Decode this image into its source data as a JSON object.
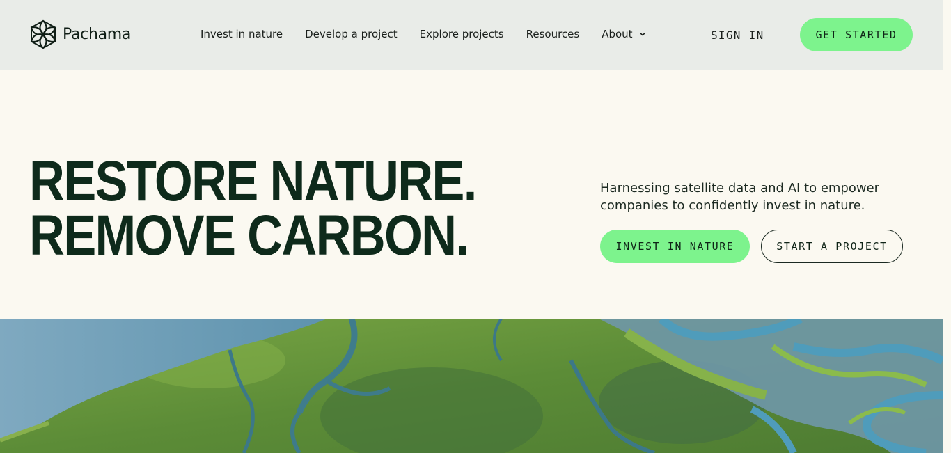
{
  "brand": {
    "name": "Pachama",
    "icon": "pachama-hexagon-flower-icon"
  },
  "nav": {
    "items": [
      {
        "label": "Invest in nature"
      },
      {
        "label": "Develop a project"
      },
      {
        "label": "Explore projects"
      },
      {
        "label": "Resources"
      },
      {
        "label": "About",
        "icon": "chevron-down-icon"
      }
    ],
    "sign_in": "SIGN IN",
    "get_started": "GET STARTED"
  },
  "hero": {
    "headline_line1": "RESTORE NATURE.",
    "headline_line2": "REMOVE CARBON.",
    "subtext": "Harnessing satellite data and AI to empower companies to confidently invest in nature.",
    "cta_primary": "INVEST IN NATURE",
    "cta_secondary": "START A PROJECT"
  },
  "colors": {
    "header_bg": "#e9ece8",
    "page_bg": "#fbf9f1",
    "accent_green": "#7df38d",
    "headline": "#0e2a1b"
  }
}
